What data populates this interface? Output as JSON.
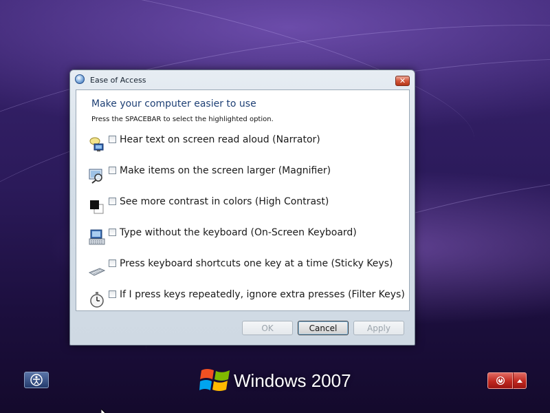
{
  "dialog": {
    "title": "Ease of Access",
    "close_glyph": "✕",
    "heading": "Make your computer easier to use",
    "instructions": "Press the SPACEBAR to select the highlighted option.",
    "options": [
      {
        "label": "Hear text on screen read aloud (Narrator)",
        "icon": "narrator-icon",
        "checked": false
      },
      {
        "label": "Make items on the screen larger (Magnifier)",
        "icon": "magnifier-icon",
        "checked": false
      },
      {
        "label": "See more contrast in colors (High Contrast)",
        "icon": "high-contrast-icon",
        "checked": false
      },
      {
        "label": "Type without the keyboard (On-Screen Keyboard)",
        "icon": "on-screen-keyboard-icon",
        "checked": false
      },
      {
        "label": "Press keyboard shortcuts one key at a time (Sticky Keys)",
        "icon": "sticky-keys-icon",
        "checked": false
      },
      {
        "label": "If I press keys repeatedly, ignore extra presses (Filter Keys)",
        "icon": "filter-keys-icon",
        "checked": false
      }
    ],
    "buttons": {
      "ok": "OK",
      "cancel": "Cancel",
      "apply": "Apply"
    }
  },
  "taskbar": {
    "brand": "Windows 2007",
    "ease_icon": "ease-of-access-icon",
    "power_icon": "power-icon",
    "power_options_icon": "chevron-up-icon"
  },
  "colors": {
    "heading": "#1d3f74",
    "power": "#c0281f",
    "background": "#2b1a5a"
  }
}
